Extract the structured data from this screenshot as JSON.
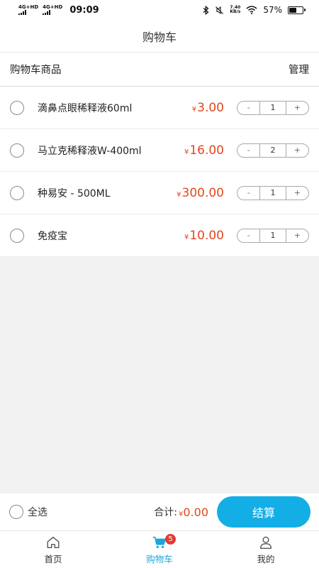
{
  "status_bar": {
    "net1": "4G+HD",
    "net2": "4G+HD",
    "time": "09:09",
    "speed_value": "7.40",
    "speed_unit": "KB/s",
    "battery": "57%",
    "battery_level": 0.57
  },
  "title": "购物车",
  "section": {
    "label": "购物车商品",
    "manage": "管理"
  },
  "currency": "¥",
  "items": [
    {
      "name": "滴鼻点眼稀释液60ml",
      "price": "3.00",
      "qty": "1"
    },
    {
      "name": "马立克稀释液W-400ml",
      "price": "16.00",
      "qty": "2"
    },
    {
      "name": "种易安 - 500ML",
      "price": "300.00",
      "qty": "1"
    },
    {
      "name": "免疫宝",
      "price": "10.00",
      "qty": "1"
    }
  ],
  "stepper": {
    "minus": "-",
    "plus": "+"
  },
  "checkout": {
    "select_all": "全选",
    "total_label": "合计:",
    "total_value": "0.00",
    "pay": "结算"
  },
  "tabs": [
    {
      "label": "首页",
      "icon": "home-icon"
    },
    {
      "label": "购物车",
      "icon": "cart-icon",
      "badge": "5"
    },
    {
      "label": "我的",
      "icon": "user-icon"
    }
  ],
  "colors": {
    "price": "#e2471d",
    "accent": "#14aee6",
    "badge": "#e53935"
  }
}
